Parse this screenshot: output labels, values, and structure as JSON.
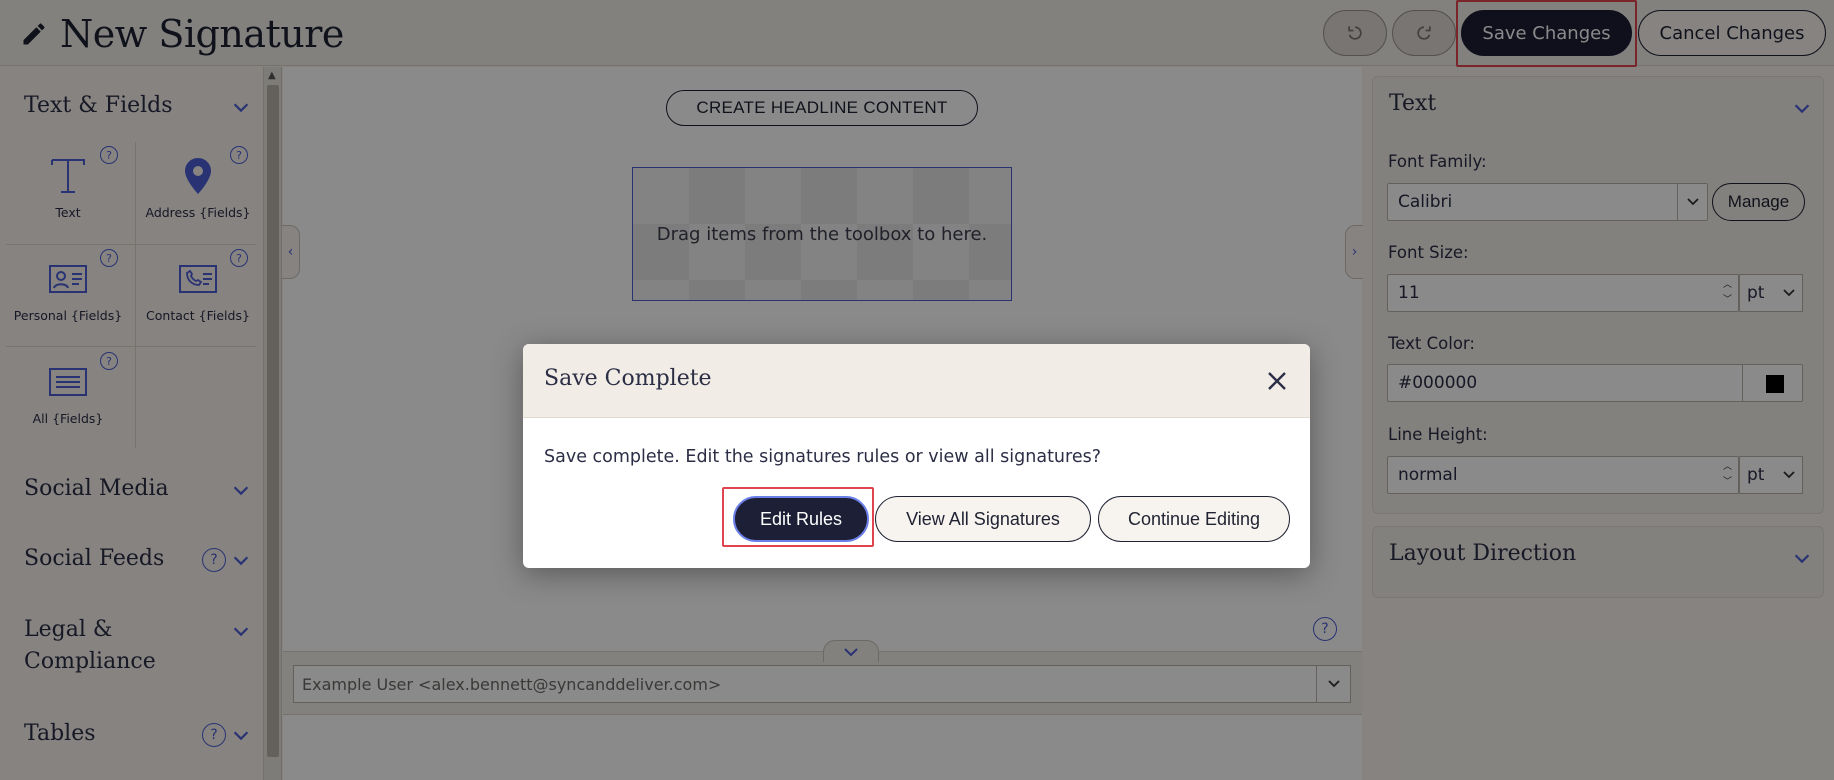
{
  "header": {
    "title": "New Signature",
    "undo_icon": "undo-icon",
    "redo_icon": "redo-icon",
    "save_label": "Save Changes",
    "cancel_label": "Cancel Changes"
  },
  "sidebar": {
    "sections": {
      "text_fields": "Text & Fields",
      "social_media": "Social Media",
      "social_feeds": "Social Feeds",
      "legal": "Legal &\nCompliance",
      "tables": "Tables"
    },
    "tools": [
      {
        "label": "Text",
        "icon": "text-icon"
      },
      {
        "label": "Address {Fields}",
        "icon": "map-pin-icon"
      },
      {
        "label": "Personal {Fields}",
        "icon": "id-card-icon"
      },
      {
        "label": "Contact {Fields}",
        "icon": "phone-card-icon"
      },
      {
        "label": "All {Fields}",
        "icon": "list-card-icon"
      }
    ],
    "help_glyph": "?"
  },
  "canvas": {
    "headline_button": "CREATE HEADLINE CONTENT",
    "dropzone_text": "Drag items from the toolbox to here.",
    "help_glyph": "?"
  },
  "preview": {
    "recipient": "Example User <alex.bennett@syncanddeliver.com>"
  },
  "properties": {
    "text_card_title": "Text",
    "font_family_label": "Font Family:",
    "font_family_value": "Calibri",
    "manage_label": "Manage",
    "font_size_label": "Font Size:",
    "font_size_value": "11",
    "font_size_unit": "pt",
    "text_color_label": "Text Color:",
    "text_color_value": "#000000",
    "line_height_label": "Line Height:",
    "line_height_value": "normal",
    "line_height_unit": "pt",
    "layout_card_title": "Layout Direction"
  },
  "modal": {
    "title": "Save Complete",
    "message": "Save complete. Edit the signatures rules or view all signatures?",
    "edit_rules": "Edit Rules",
    "view_all": "View All Signatures",
    "continue": "Continue Editing"
  },
  "colors": {
    "navy": "#1c1f35",
    "accent_blue": "#4c5ed6",
    "highlight_red": "#e0454f",
    "cream": "#f7f3ee"
  }
}
